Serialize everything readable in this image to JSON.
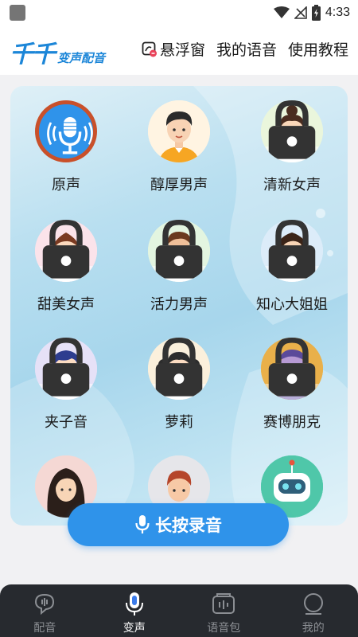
{
  "status_bar": {
    "time": "4:33"
  },
  "header": {
    "logo_main": "千千",
    "logo_sub": "变声配音",
    "nav": [
      {
        "label": "悬浮窗",
        "icon": "floating-window-icon"
      },
      {
        "label": "我的语音",
        "icon": ""
      },
      {
        "label": "使用教程",
        "icon": ""
      }
    ]
  },
  "voices": [
    {
      "label": "原声",
      "avatar": "microphone",
      "locked": false
    },
    {
      "label": "醇厚男声",
      "avatar": "man-orange",
      "locked": false
    },
    {
      "label": "清新女声",
      "avatar": "woman-bun",
      "locked": true
    },
    {
      "label": "甜美女声",
      "avatar": "girl-glasses",
      "locked": true
    },
    {
      "label": "活力男声",
      "avatar": "boy-green",
      "locked": true
    },
    {
      "label": "知心大姐姐",
      "avatar": "woman-long-hair",
      "locked": true
    },
    {
      "label": "夹子音",
      "avatar": "girl-blue-hair",
      "locked": true
    },
    {
      "label": "萝莉",
      "avatar": "girl-pigtails",
      "locked": true
    },
    {
      "label": "赛博朋克",
      "avatar": "cyber-robot",
      "locked": true
    },
    {
      "label": "",
      "avatar": "woman-dark-hair",
      "locked": false
    },
    {
      "label": "",
      "avatar": "boy-red-hair",
      "locked": false
    },
    {
      "label": "",
      "avatar": "robot-green",
      "locked": false
    }
  ],
  "record_button": {
    "label": "长按录音"
  },
  "bottom_nav": [
    {
      "label": "配音",
      "icon": "dubbing-icon",
      "active": false
    },
    {
      "label": "变声",
      "icon": "voice-change-mic-icon",
      "active": true
    },
    {
      "label": "语音包",
      "icon": "voice-pack-icon",
      "active": false
    },
    {
      "label": "我的",
      "icon": "profile-icon",
      "active": false
    }
  ],
  "colors": {
    "accent": "#2f93ea",
    "logo": "#1c86d8",
    "nav_bg": "#272a2f",
    "mic_ring": "#c9502a"
  }
}
